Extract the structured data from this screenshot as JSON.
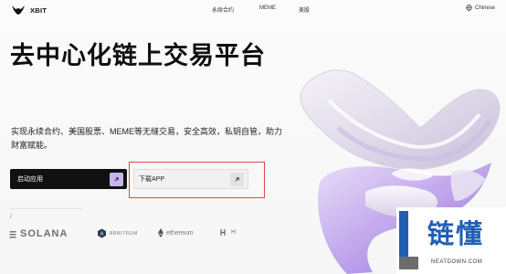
{
  "header": {
    "logo_text": "XBIT",
    "nav": [
      "永续合约",
      "MEME",
      "美股"
    ],
    "language": "Chinese"
  },
  "hero": {
    "title": "去中心化链上交易平台",
    "description": "实现永续合约、美国股票、MEME等无缝交易，安全高效，私钥自管，助力财富赋能。"
  },
  "buttons": {
    "launch": "启动应用",
    "download": "下载APP"
  },
  "small_mark": "/",
  "partners": {
    "solana": "SOLANA",
    "arbitrum": "ARBITRUM",
    "ethereum": "ethereum",
    "hplus": "H"
  },
  "watermark": {
    "text": "链懂",
    "url": "NEATDOWN.COM"
  },
  "colors": {
    "accent_purple": "#c9b5ee",
    "highlight_red": "#e14747",
    "watermark_blue": "#1e5fb3"
  }
}
